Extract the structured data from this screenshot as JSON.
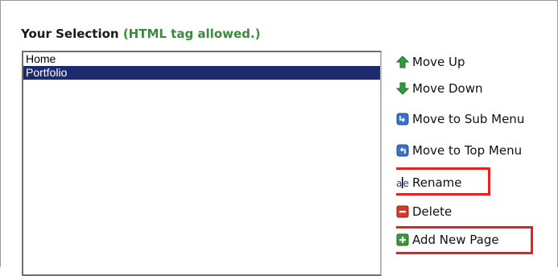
{
  "section": {
    "title": "Your Selection",
    "note": "(HTML tag allowed.)"
  },
  "list": {
    "items": [
      "Home",
      "Portfolio"
    ],
    "selected": "Portfolio"
  },
  "actions": {
    "move_up": "Move Up",
    "move_down": "Move Down",
    "move_sub": "Move to Sub Menu",
    "move_top": "Move to Top Menu",
    "rename": "Rename",
    "delete": "Delete",
    "add_page": "Add New Page"
  },
  "icons": {
    "move_up": "arrow-up-icon",
    "move_down": "arrow-down-icon",
    "move_sub": "move-sub-menu-icon",
    "move_top": "move-top-menu-icon",
    "rename": "rename-icon",
    "delete": "delete-icon",
    "add_page": "add-page-icon"
  },
  "colors": {
    "title_note": "#3b8a3b",
    "selection": "#1c2a6e",
    "highlight": "#e52222"
  }
}
